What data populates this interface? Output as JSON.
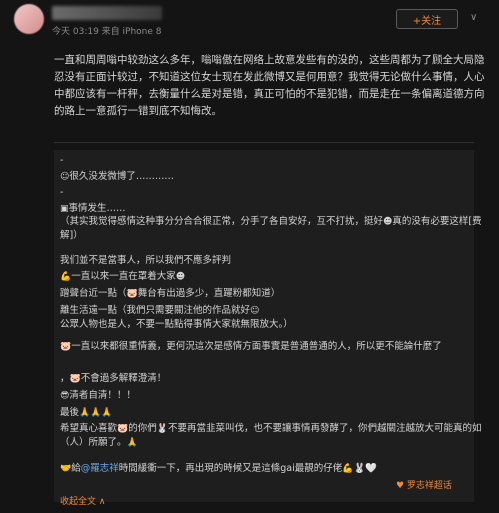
{
  "header": {
    "meta": "今天 03:19 来自 iPhone 8",
    "follow": "+关注",
    "chevron": "∨"
  },
  "post": {
    "text": "一直和周周嗡中较劲这么多年，嗡嗡傲在网络上故意发些有的没的，这些周都为了顾全大局隐忍没有正面计较过，不知道这位女士现在发此微博又是何用意？我觉得无论做什么事情，人心中都应该有一杆秤，去衡量什么是对是错，真正可怕的不是犯错，而是走在一条偏离道德方向的路上一意孤行一错到底不知悔改。"
  },
  "repost": {
    "lines": [
      {
        "emoji": "",
        "text": "-"
      },
      {
        "emoji": "☺",
        "text": "很久没发微博了…………"
      },
      {
        "emoji": "",
        "text": "-"
      },
      {
        "emoji": "▣",
        "text": "事情发生……"
      },
      {
        "emoji": "",
        "text": "（其实我觉得感情这种事分分合合很正常，分手了各自安好，互不打扰，挺好",
        "after_emoji": "☻",
        "after_text": "真的没有必要这样[费解]）"
      },
      {
        "emoji": "",
        "text": "我们並不是當事人，所以我們不應多評判"
      },
      {
        "emoji": "💪",
        "text": "一直以來一直在罩着大家",
        "after_emoji": "☻",
        "after_text": ""
      },
      {
        "emoji": "",
        "text": "蹭聲台近一點（",
        "after_emoji": "🐷",
        "after_text": "舞台有出過多少，直躍粉都知道）"
      },
      {
        "emoji": "",
        "text": "離生活遠一點（我們只需要關注他的作品就好",
        "after_emoji": "☺",
        "after_text": "公眾人物也是人，不要一點點得事情大家就無限放大。）"
      },
      {
        "emoji": "🐷",
        "text": "一直以來都很重情義，更何況這次是感情方面事實是普通普通的人，所以更不能論什麼了",
        "after_emoji": "",
        "after_text": ""
      },
      {
        "emoji": "",
        "text": "，",
        "after_emoji": "🐷",
        "after_text": "不會過多解釋澄清！"
      },
      {
        "emoji": "😎",
        "text": "清者自清！！！"
      },
      {
        "emoji": "",
        "text": "最後",
        "after_emoji": "🙏🙏🙏",
        "after_text": ""
      },
      {
        "emoji": "",
        "text": "希望真心喜歡",
        "after_emoji": "🐷",
        "after_text": "的你們",
        "after_emoji2": "🐰",
        "after_text2": "不要再當韭菜叫伐，也不要讓事情再發酵了，你們越關注越放大可能真的如（人）所願了。",
        "after_emoji3": "🙏"
      },
      {
        "emoji": "",
        "text": ""
      },
      {
        "emoji": "🤝",
        "text": "給",
        "link": "@羅志祥",
        "after_text": "時間緩衝一下，再出現的時候又是這條gai最靚的仔佬",
        "after_emoji": "💪",
        "after_text2": "🐰🤍"
      }
    ],
    "watermark": "♥ 罗志祥超话",
    "expand": "收起全文 ∧"
  },
  "colors": {
    "accent": "#f08a3c",
    "link": "#6fa7e6",
    "background": "#141414"
  }
}
